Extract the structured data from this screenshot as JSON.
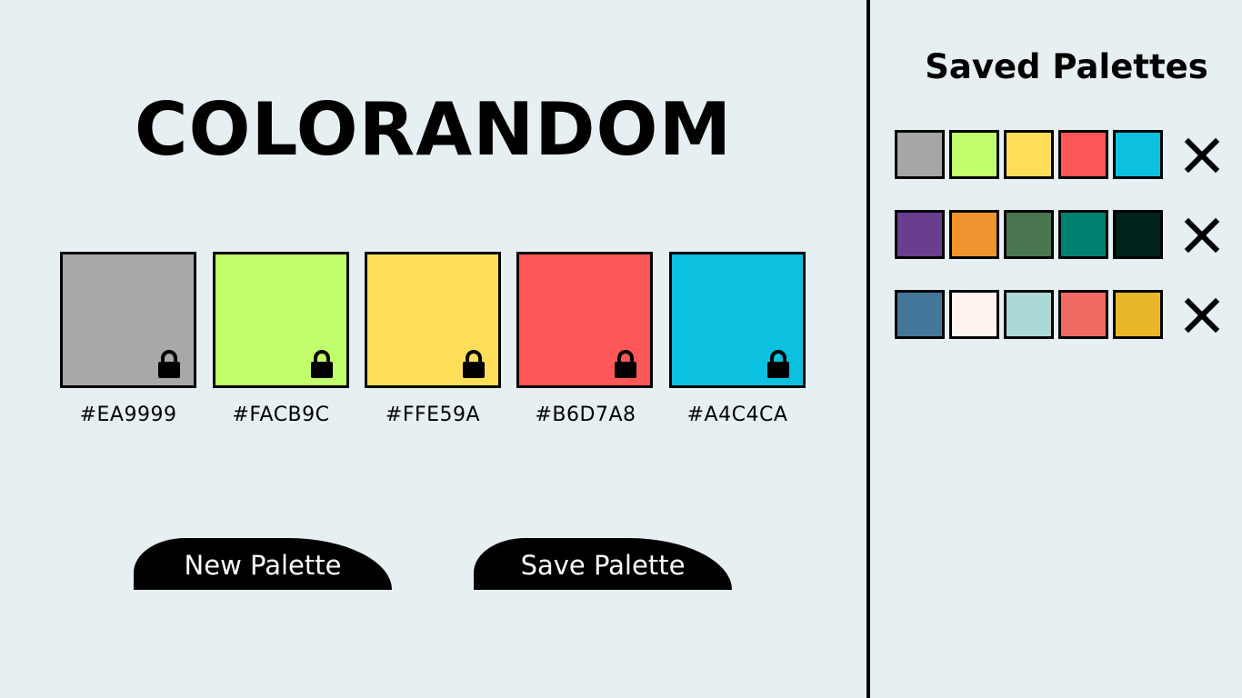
{
  "app": {
    "title": "COLORANDOM"
  },
  "current_palette": [
    {
      "hex_label": "#EA9999",
      "color": "#a8a8a8",
      "lock_icon": "padlock-icon"
    },
    {
      "hex_label": "#FACB9C",
      "color": "#c1ff6c",
      "lock_icon": "padlock-icon"
    },
    {
      "hex_label": "#FFE59A",
      "color": "#ffdf5a",
      "lock_icon": "padlock-icon"
    },
    {
      "hex_label": "#B6D7A8",
      "color": "#ff5757",
      "lock_icon": "padlock-icon"
    },
    {
      "hex_label": "#A4C4CA",
      "color": "#0cc0df",
      "lock_icon": "padlock-icon"
    }
  ],
  "buttons": {
    "new_palette": "New Palette",
    "save_palette": "Save Palette"
  },
  "saved": {
    "title": "Saved Palettes",
    "palettes": [
      {
        "colors": [
          "#a6a6a6",
          "#c1ff6c",
          "#ffdf5a",
          "#ff5757",
          "#0cc0df"
        ],
        "delete_icon": "close-x-icon"
      },
      {
        "colors": [
          "#6a3d8f",
          "#f0942f",
          "#4a7750",
          "#00816f",
          "#00231c"
        ],
        "delete_icon": "close-x-icon"
      },
      {
        "colors": [
          "#43779a",
          "#fff4f0",
          "#acd8d8",
          "#f06a64",
          "#eab72b"
        ],
        "delete_icon": "close-x-icon"
      }
    ]
  },
  "colors": {
    "background": "#e6eff1",
    "ink": "#000000",
    "button_text": "#ffffff"
  }
}
